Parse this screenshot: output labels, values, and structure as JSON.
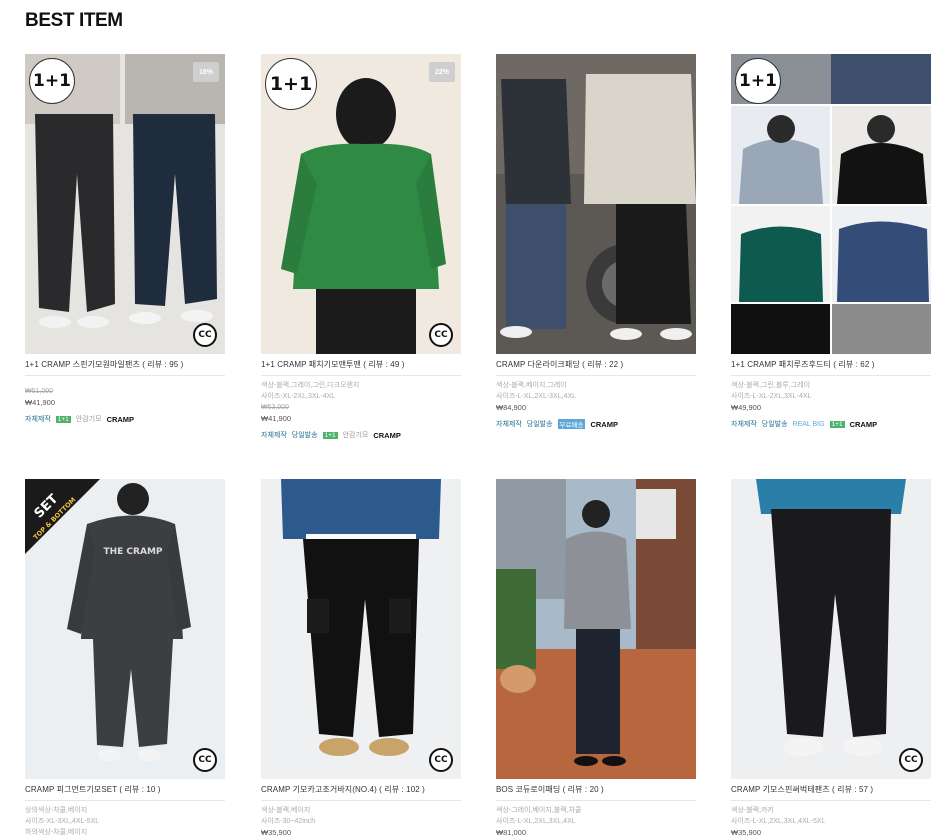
{
  "section_title": "BEST ITEM",
  "products": [
    {
      "name": "1+1 CRAMP 스핀기모원마일팬츠 ( 리뷰 : 95 )",
      "info": [],
      "original_price": "₩51,000",
      "price": "₩41,900",
      "tags": [
        "자체제작",
        "1+1",
        "안감기모",
        "CRAMP"
      ],
      "badge": "1+1",
      "discount": "18%"
    },
    {
      "name": "1+1 CRAMP 패치기모맨투맨 ( 리뷰 : 49 )",
      "info": [
        "색상-블랙,그레이,그린,다크오렌지",
        "사이즈-XL-2XL,3XL-4XL"
      ],
      "original_price": "₩53,000",
      "price": "₩41,900",
      "tags": [
        "자체제작",
        "당일발송",
        "1+1",
        "안감기모",
        "CRAMP"
      ],
      "badge": "1+1",
      "discount": "22%"
    },
    {
      "name": "CRAMP 다운라이크패딩 ( 리뷰 : 22 )",
      "info": [
        "색상-블랙,베이지,그레이",
        "사이즈-L-XL,2XL-3XL,4XL"
      ],
      "original_price": "",
      "price": "₩84,900",
      "tags": [
        "자체제작",
        "당일발송",
        "무료배송",
        "CRAMP"
      ],
      "badge": "",
      "discount": ""
    },
    {
      "name": "1+1 CRAMP 패치루즈후드티 ( 리뷰 : 62 )",
      "info": [
        "색상-블랙,그린,블루,그레이",
        "사이즈-L-XL-2XL,3XL-4XL"
      ],
      "original_price": "",
      "price": "₩49,900",
      "tags": [
        "자체제작",
        "당일발송",
        "REAL BIG",
        "1+1",
        "CRAMP"
      ],
      "badge": "1+1",
      "discount": ""
    },
    {
      "name": "CRAMP 피그먼트기모SET ( 리뷰 : 10 )",
      "info": [
        "상의색상-차콜,베이지",
        "사이즈-XL-3XL,4XL-5XL",
        "하의색상-차콜,베이지"
      ],
      "original_price": "",
      "price": "",
      "tags": [],
      "badge": "SET",
      "ribbon": {
        "line1": "SET",
        "line2": "TOP & BOTTOM"
      },
      "discount": ""
    },
    {
      "name": "CRAMP 기모카고조거바지(NO.4) ( 리뷰 : 102 )",
      "info": [
        "색상-블랙,베이지",
        "사이즈-30~42inch"
      ],
      "original_price": "",
      "price": "₩35,900",
      "tags": [],
      "badge": "",
      "discount": ""
    },
    {
      "name": "BOS 코듀로이패딩 ( 리뷰 : 20 )",
      "info": [
        "색상-그레이,베이지,블랙,차콜",
        "사이즈-L-XL,2XL,3XL,4XL"
      ],
      "original_price": "",
      "price": "₩81,000",
      "tags": [],
      "badge": "",
      "discount": ""
    },
    {
      "name": "CRAMP 기모스핀써벅테팬츠 ( 리뷰 : 57 )",
      "info": [
        "색상-블랙,카키",
        "사이즈-L-XL,2XL,3XL,4XL-5XL"
      ],
      "original_price": "",
      "price": "₩35,900",
      "tags": [],
      "badge": "",
      "discount": ""
    }
  ],
  "colors": {
    "tag_text": "#1a6f8f",
    "tag_green": "#4db36b",
    "tag_blue": "#5ba8d6",
    "realbig": "#5aaed8"
  }
}
